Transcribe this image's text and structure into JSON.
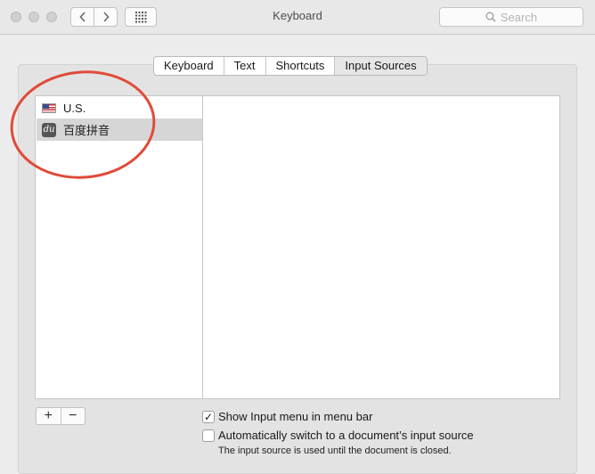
{
  "window": {
    "title": "Keyboard"
  },
  "search": {
    "placeholder": "Search",
    "icon": "search-icon"
  },
  "tabs": [
    {
      "label": "Keyboard"
    },
    {
      "label": "Text"
    },
    {
      "label": "Shortcuts"
    },
    {
      "label": "Input Sources",
      "active": true
    }
  ],
  "input_sources": [
    {
      "label": "U.S.",
      "icon": "us-flag-icon"
    },
    {
      "label": "百度拼音",
      "icon": "baidu-pinyin-icon",
      "selected": true
    }
  ],
  "buttons": {
    "add": "+",
    "remove": "−"
  },
  "options": {
    "show_input_menu": {
      "label": "Show Input menu in menu bar",
      "checked": true,
      "mark": "✓"
    },
    "auto_switch": {
      "label": "Automatically switch to a document’s input source",
      "checked": false
    },
    "note": "The input source is used until the document is closed."
  },
  "colors": {
    "annotation": "#e04b3a",
    "selection": "#d6d6d6"
  }
}
